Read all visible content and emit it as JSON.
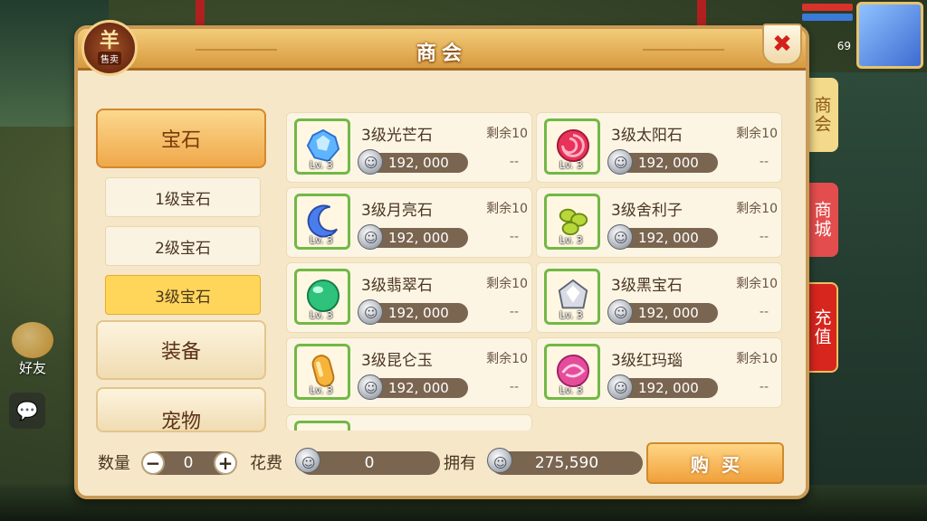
{
  "window": {
    "title": "商会"
  },
  "emblem": {
    "big": "羊",
    "small": "售卖"
  },
  "hud": {
    "level": "69"
  },
  "side_left": {
    "friends_label": "好友"
  },
  "side_tabs": [
    {
      "label": "商会",
      "color": "#f3d98a",
      "text_color": "#8a5a14"
    },
    {
      "label": "商城",
      "color": "#e44d4d",
      "text_color": "#ffffff"
    },
    {
      "label": "充值",
      "color": "#d7261e",
      "text_color": "#ffffff"
    }
  ],
  "categories": {
    "main": [
      {
        "label": "宝石",
        "active": true
      },
      {
        "label": "装备",
        "active": false
      },
      {
        "label": "宠物",
        "active": false
      }
    ],
    "sub": [
      {
        "label": "1级宝石",
        "selected": false
      },
      {
        "label": "2级宝石",
        "selected": false
      },
      {
        "label": "3级宝石",
        "selected": true
      }
    ]
  },
  "items": [
    {
      "name": "3级光芒石",
      "remain": "剩余10",
      "price": "192, 000",
      "dash": "--",
      "level": "Lv. 3",
      "gem": "blue-crystal"
    },
    {
      "name": "3级太阳石",
      "remain": "剩余10",
      "price": "192, 000",
      "dash": "--",
      "level": "Lv. 3",
      "gem": "red-swirl"
    },
    {
      "name": "3级月亮石",
      "remain": "剩余10",
      "price": "192, 000",
      "dash": "--",
      "level": "Lv. 3",
      "gem": "blue-moon"
    },
    {
      "name": "3级舍利子",
      "remain": "剩余10",
      "price": "192, 000",
      "dash": "--",
      "level": "Lv. 3",
      "gem": "green-beads"
    },
    {
      "name": "3级翡翠石",
      "remain": "剩余10",
      "price": "192, 000",
      "dash": "--",
      "level": "Lv. 3",
      "gem": "green-orb"
    },
    {
      "name": "3级黑宝石",
      "remain": "剩余10",
      "price": "192, 000",
      "dash": "--",
      "level": "Lv. 3",
      "gem": "silver-diamond"
    },
    {
      "name": "3级昆仑玉",
      "remain": "剩余10",
      "price": "192, 000",
      "dash": "--",
      "level": "Lv. 3",
      "gem": "orange-jade"
    },
    {
      "name": "3级红玛瑙",
      "remain": "剩余10",
      "price": "192, 000",
      "dash": "--",
      "level": "Lv. 3",
      "gem": "pink-swirl"
    }
  ],
  "bottom": {
    "quantity_label": "数量",
    "quantity_value": "0",
    "cost_label": "花费",
    "cost_value": "0",
    "own_label": "拥有",
    "own_value": "275,590",
    "buy_label": "购买"
  }
}
